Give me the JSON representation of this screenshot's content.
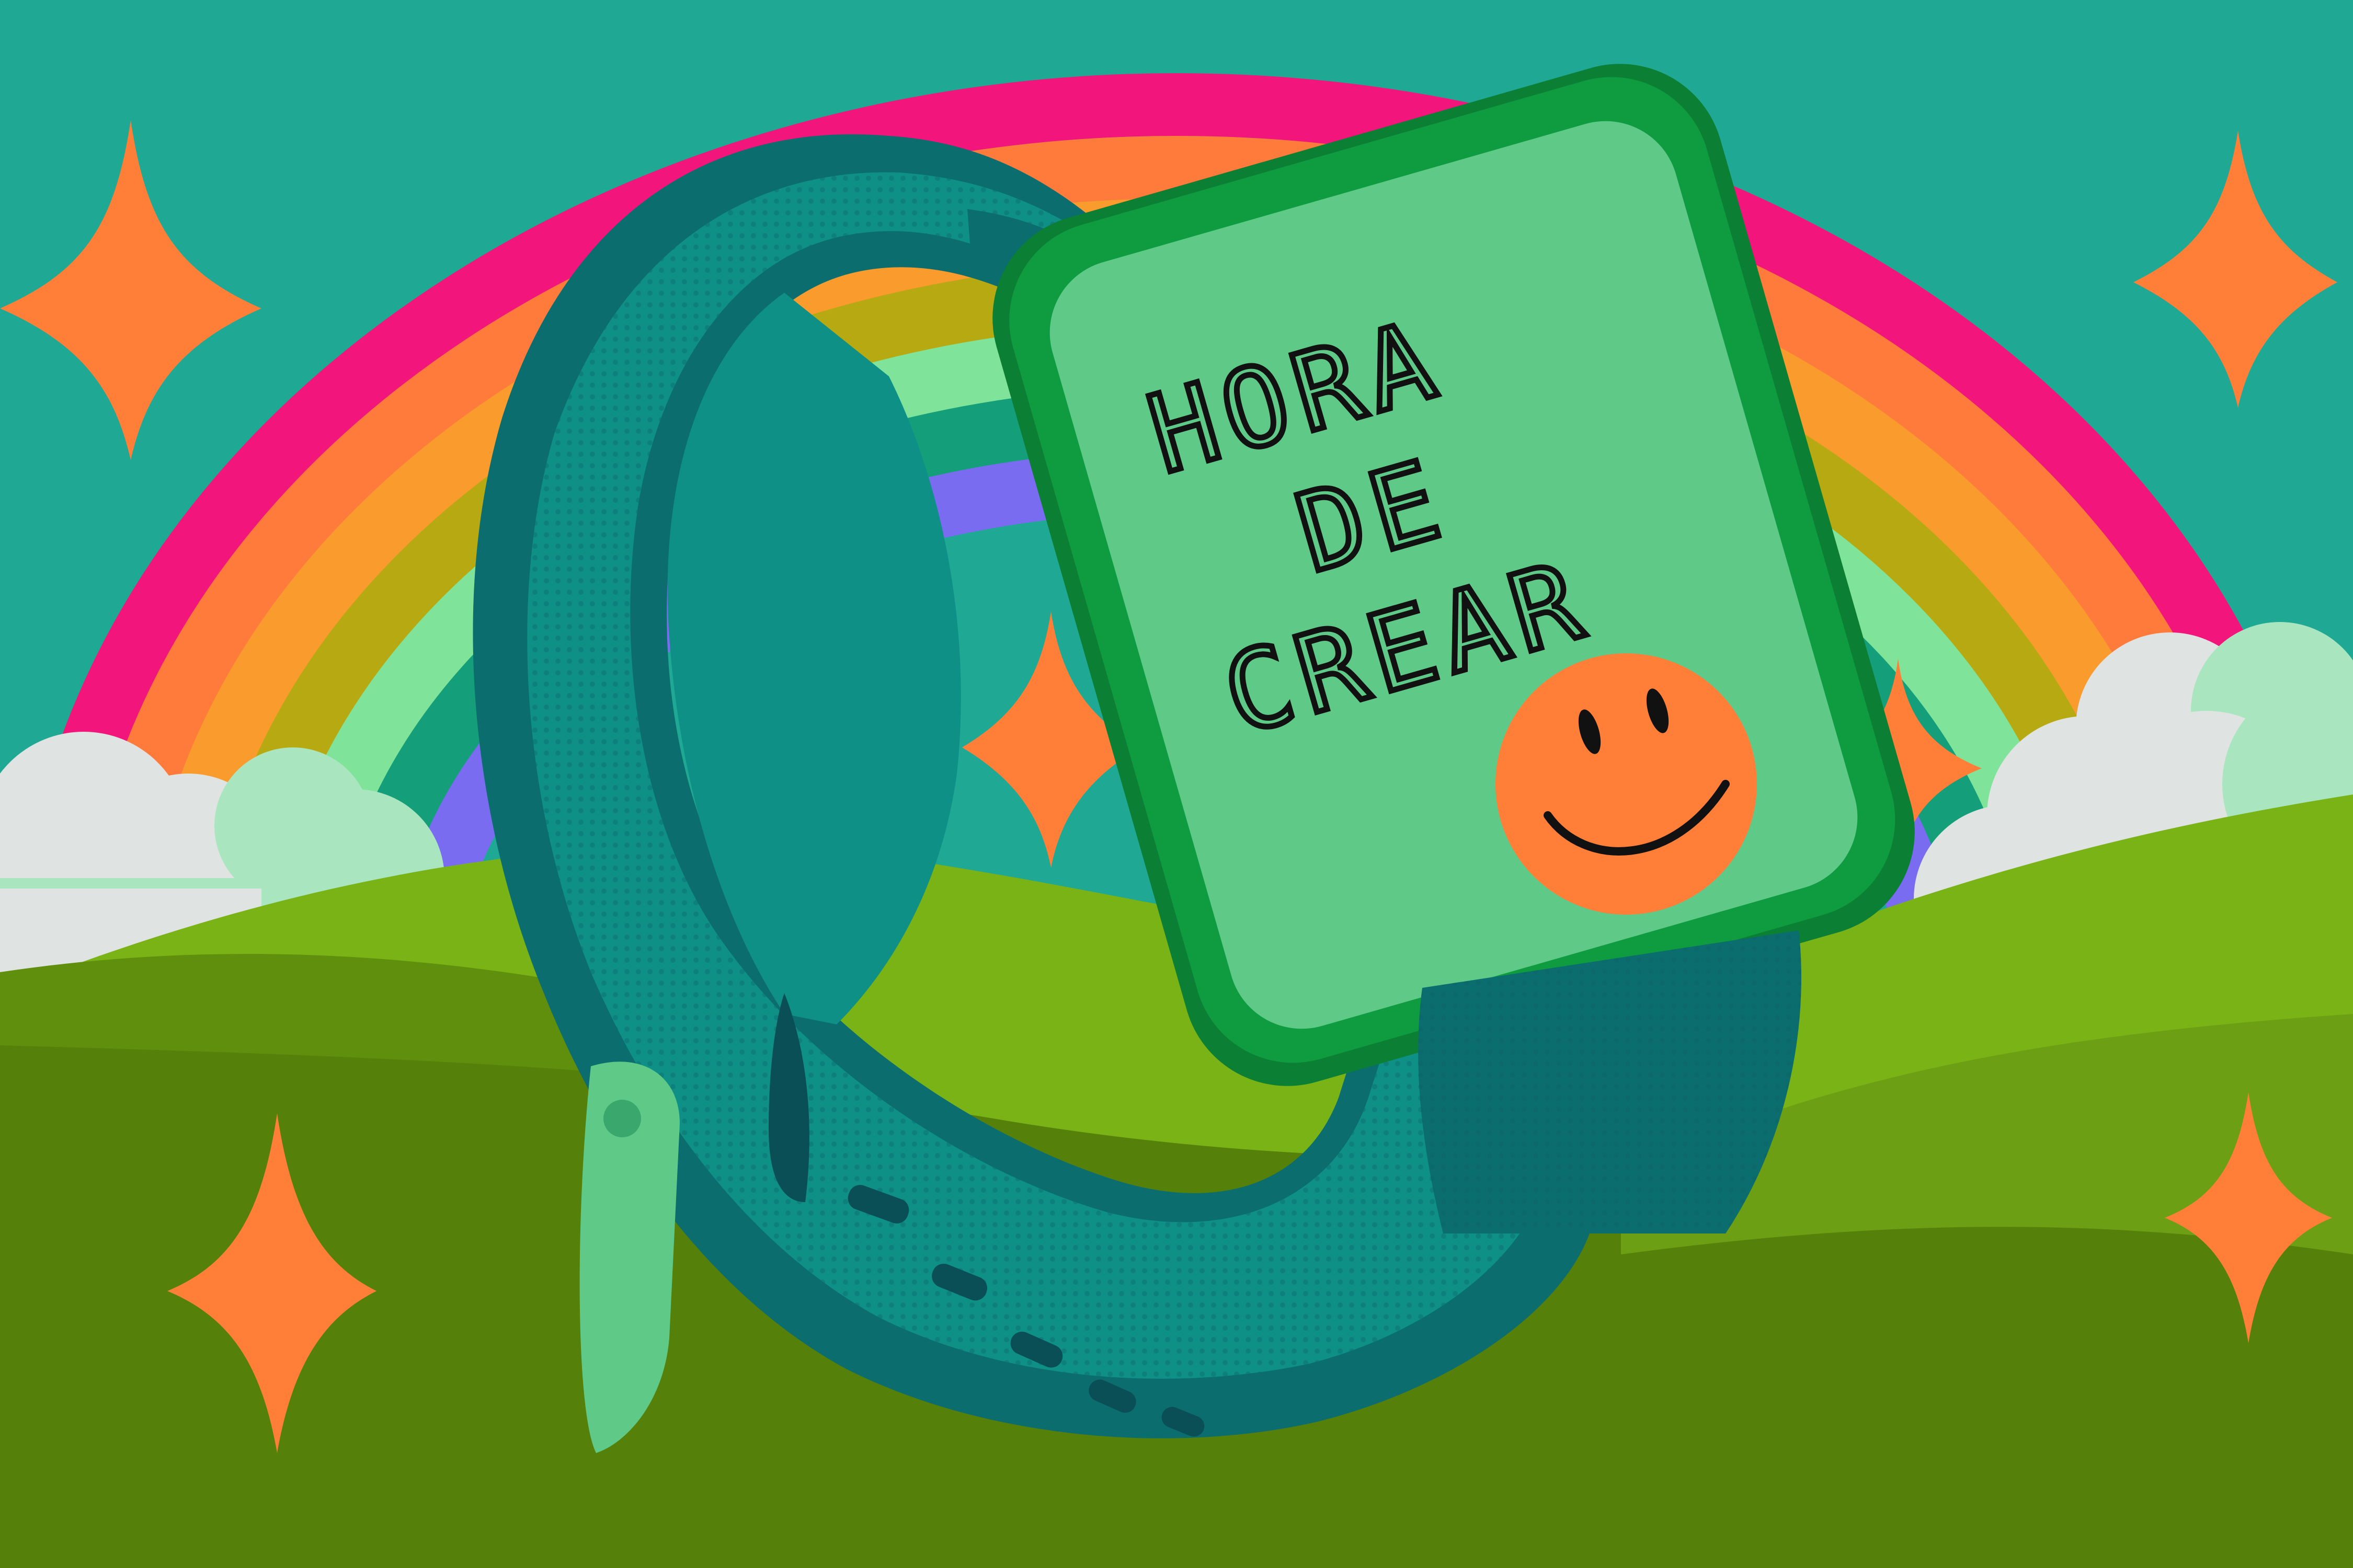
{
  "watch": {
    "screen_lines": [
      "HORA",
      "DE",
      "CREAR"
    ]
  },
  "colors": {
    "sky": "#1fa994",
    "rainbow": [
      "#f2157c",
      "#ff7b3b",
      "#f99b2d",
      "#b7a912",
      "#7fe49a",
      "#149e7a",
      "#7a6cf0"
    ],
    "sparkle": "#ff7f38",
    "cloud": "#dfe3e1",
    "hill_back": "#7ab316",
    "hill_front": "#55800a",
    "strap": "#0e9087",
    "strap_shadow": "#0c6d6e",
    "case": "#0f9b3f",
    "screen": "#5fca88",
    "smiley": "#ff7f38"
  },
  "icons": [
    "sparkle-icon",
    "smiley-icon"
  ]
}
